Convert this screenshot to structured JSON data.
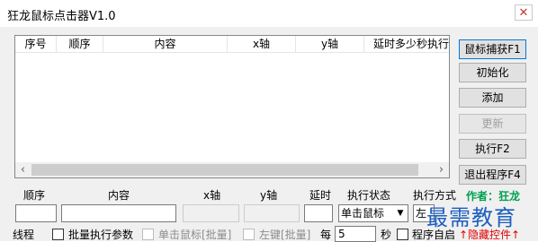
{
  "window": {
    "title": "狂龙鼠标点击器V1.0",
    "close_glyph": "✕"
  },
  "list": {
    "columns": [
      "序号",
      "顺序",
      "内容",
      "x轴",
      "y轴",
      "延时多少秒执行"
    ],
    "scroll_left": "‹",
    "scroll_right": "›"
  },
  "buttons": {
    "capture": "鼠标捕获F1",
    "init": "初始化",
    "add": "添加",
    "update": "更新",
    "execute": "执行F2",
    "exit": "退出程序F4"
  },
  "form": {
    "labels": {
      "order": "顺序",
      "content": "内容",
      "x": "x轴",
      "y": "y轴",
      "delay": "延时",
      "exec_state": "执行状态",
      "exec_mode": "执行方式"
    },
    "exec_state_value": "单击鼠标",
    "exec_mode_value": "左",
    "author": "作者：狂龙"
  },
  "bottom": {
    "thread": "线程",
    "batch_params": "批量执行参数",
    "single_click_batch": "单击鼠标[批量]",
    "left_key_batch": "左键[批量]",
    "every": "每",
    "seconds_value": "5",
    "seconds": "秒",
    "autostart": "程序自启",
    "hide_controls": "↑隐藏控件↑"
  },
  "watermark": "最需教育",
  "colors": {
    "accent": "#0078d7",
    "author": "#00a050",
    "hide": "#e00000",
    "watermark": "#1d5fbf"
  }
}
